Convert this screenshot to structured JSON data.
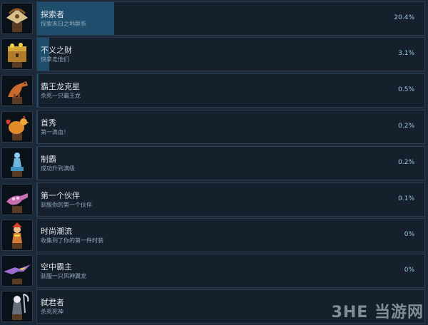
{
  "achievements": [
    {
      "title": "探索者",
      "desc": "探索末日之地群系",
      "percent": "20.4%",
      "fill": 0.204,
      "icon": "treasure-map-icon",
      "color": "#c9a24a"
    },
    {
      "title": "不义之财",
      "desc": "快拿走他们",
      "percent": "3.1%",
      "fill": 0.031,
      "icon": "treasure-chest-icon",
      "color": "#d4a537"
    },
    {
      "title": "霸王龙克星",
      "desc": "杀死一只霸王龙",
      "percent": "0.5%",
      "fill": 0.005,
      "icon": "trex-icon",
      "color": "#c8692e"
    },
    {
      "title": "首秀",
      "desc": "第一滴血！",
      "percent": "0.2%",
      "fill": 0.002,
      "icon": "rooster-icon",
      "color": "#e08a2a"
    },
    {
      "title": "制霸",
      "desc": "成功升到满级",
      "percent": "0.2%",
      "fill": 0.002,
      "icon": "statue-icon",
      "color": "#6fb6e0"
    },
    {
      "title": "第一个伙伴",
      "desc": "驯服你的第一个伙伴",
      "percent": "0.1%",
      "fill": 0.001,
      "icon": "pet-dinosaur-icon",
      "color": "#c86fb4"
    },
    {
      "title": "时尚潮流",
      "desc": "收集到了你的第一件时装",
      "percent": "0%",
      "fill": 0,
      "icon": "costume-icon",
      "color": "#d67a3a"
    },
    {
      "title": "空中霸主",
      "desc": "驯服一只风神翼龙",
      "percent": "0%",
      "fill": 0,
      "icon": "pterodactyl-icon",
      "color": "#9a6fd0"
    },
    {
      "title": "弑君者",
      "desc": "杀死死神",
      "percent": "",
      "fill": 0,
      "icon": "reaper-icon",
      "color": "#b0b8c8"
    }
  ],
  "watermark": "3HE 当游网"
}
